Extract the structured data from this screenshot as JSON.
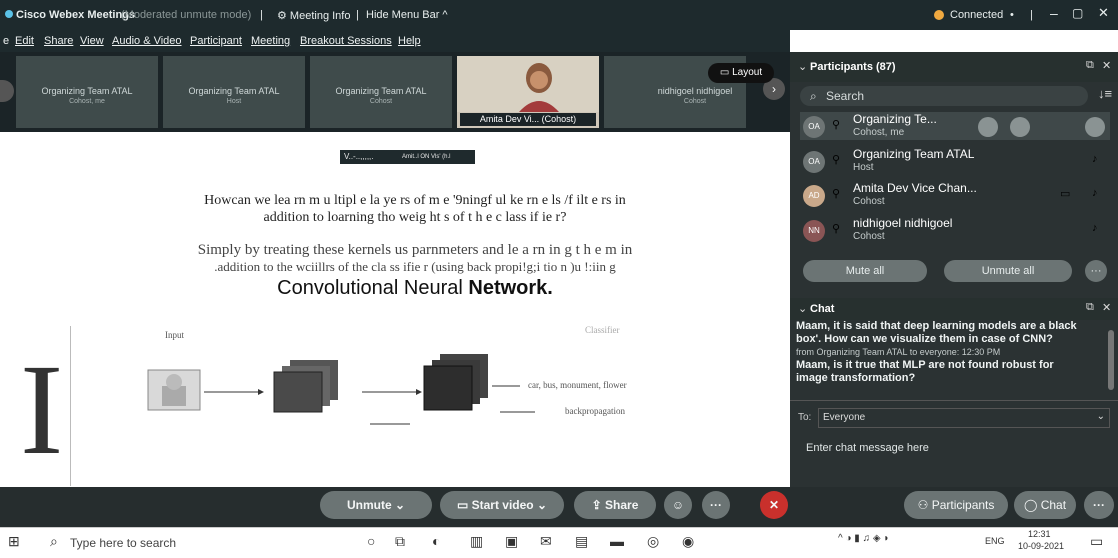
{
  "titlebar": {
    "app_title": "Cisco Webex Meetings",
    "mode": "(Moderated unmute mode)",
    "meeting_info": "Meeting Info",
    "hide_menu_bar": "Hide Menu Bar ^",
    "connected": "Connected",
    "sep": "|"
  },
  "menu": [
    "Edit",
    "Share",
    "View",
    "Audio & Video",
    "Participant",
    "Meeting",
    "Breakout Sessions",
    "Help"
  ],
  "menu_prefix": "e",
  "video_strip": {
    "tiles": [
      {
        "name": "Organizing Team ATAL",
        "role": "Cohost, me"
      },
      {
        "name": "Organizing Team ATAL",
        "role": "Host"
      },
      {
        "name": "Organizing Team ATAL",
        "role": "Cohost"
      },
      {
        "name": "Amita Dev Vi... (Cohost)",
        "role": ""
      },
      {
        "name": "nidhigoel nidhigoel",
        "role": "Cohost"
      }
    ],
    "layout_label": "Layout"
  },
  "slide": {
    "header_text": "V..-..,,,,,.",
    "header_sub": "Amit..l ON Vls' (h.l",
    "q_line1": "Howcan we lea rn m u ltipl e la ye rs of m e '9ningf ul ke rn e ls /f ilt e rs in",
    "q_line2": "addition to loarning tho weig ht s of t h e c lass if ie r?",
    "a_line1": "Simply by treating these kernels us parnmeters and le a rn in g t h e m in",
    "a_line2": ".addition to the wciillrs of the cla ss ifie r (using back propi!g;i tio n )u !:iin g",
    "title_normal": "Convolutional Neural",
    "title_bold": "Network.",
    "big_letter": "I",
    "fig_input": "Input",
    "fig_classes": "car, bus, monument, flower",
    "fig_backprop": "backpropagation",
    "fig_classifier": "Classifier"
  },
  "participants": {
    "header": "Participants (87)",
    "search_placeholder": "Search",
    "list": [
      {
        "initials": "OA",
        "name": "Organizing Te...",
        "role": "Cohost, me"
      },
      {
        "initials": "OA",
        "name": "Organizing Team ATAL",
        "role": "Host"
      },
      {
        "initials": "AD",
        "name": "Amita Dev Vice Chan...",
        "role": "Cohost"
      },
      {
        "initials": "NN",
        "name": "nidhigoel nidhigoel",
        "role": "Cohost"
      }
    ],
    "mute_all": "Mute all",
    "unmute_all": "Unmute all"
  },
  "chat": {
    "header": "Chat",
    "lines": [
      "Maam, it is said that deep learning models are a black",
      "box'. How can we visualize them in case of CNN?",
      "from Organizing Team ATAL to everyone:   12:30 PM",
      "Maam, is it true that MLP are not found robust for",
      "image transformation?"
    ],
    "to_label": "To:",
    "to_value": "Everyone",
    "input_placeholder": "Enter chat message here"
  },
  "controls": {
    "unmute": "Unmute",
    "start_video": "Start video",
    "share": "Share",
    "participants": "Participants",
    "chat": "Chat"
  },
  "taskbar": {
    "search_placeholder": "Type here to search",
    "lang": "ENG",
    "time": "12:31",
    "date": "10-09-2021"
  },
  "colors": {
    "webex_dark": "#1e2a2d",
    "panel": "#2b3233",
    "button_gray": "#6b7474",
    "end_red": "#c9302c"
  }
}
